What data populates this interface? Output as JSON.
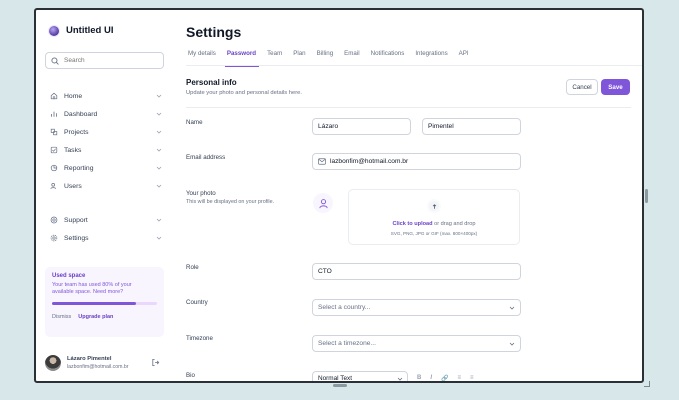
{
  "app": {
    "name": "Untitled UI",
    "brand_color": "#7f56d9"
  },
  "search": {
    "placeholder": "Search"
  },
  "nav": [
    {
      "label": "Home",
      "icon": "home-icon"
    },
    {
      "label": "Dashboard",
      "icon": "bar-chart-icon"
    },
    {
      "label": "Projects",
      "icon": "layers-icon"
    },
    {
      "label": "Tasks",
      "icon": "check-square-icon"
    },
    {
      "label": "Reporting",
      "icon": "pie-chart-icon"
    },
    {
      "label": "Users",
      "icon": "users-icon"
    }
  ],
  "nav_bottom": [
    {
      "label": "Support",
      "icon": "life-buoy-icon"
    },
    {
      "label": "Settings",
      "icon": "gear-icon"
    }
  ],
  "usage": {
    "title": "Used space",
    "desc_line1": "Your team has used 80% of your",
    "desc_line2": "available space. Need more?",
    "percent": 80,
    "dismiss": "Dismiss",
    "upgrade": "Upgrade plan"
  },
  "account": {
    "name": "Lázaro Pimentel",
    "email": "lazbonfim@hotmail.com.br"
  },
  "page": {
    "title": "Settings"
  },
  "tabs": [
    "My details",
    "Password",
    "Team",
    "Plan",
    "Billing",
    "Email",
    "Notifications",
    "Integrations",
    "API"
  ],
  "active_tab": "Password",
  "section": {
    "title": "Personal info",
    "subtitle": "Update your photo and personal details here."
  },
  "buttons": {
    "cancel": "Cancel",
    "save": "Save"
  },
  "form": {
    "name_label": "Name",
    "first_name": "Lázaro",
    "last_name": "Pimentel",
    "email_label": "Email address",
    "email": "lazbonfim@hotmail.com.br",
    "photo_label": "Your photo",
    "photo_help": "This will be displayed on your profile.",
    "upload_link": "Click to upload",
    "upload_rest": " or drag and drop",
    "upload_hint": "SVG, PNG, JPG or GIF (max. 800×400px)",
    "role_label": "Role",
    "role": "CTO",
    "country_label": "Country",
    "country_placeholder": "Select a country...",
    "timezone_label": "Timezone",
    "timezone_placeholder": "Select a timezone...",
    "bio_label": "Bio",
    "bio_format": "Normal Text"
  }
}
